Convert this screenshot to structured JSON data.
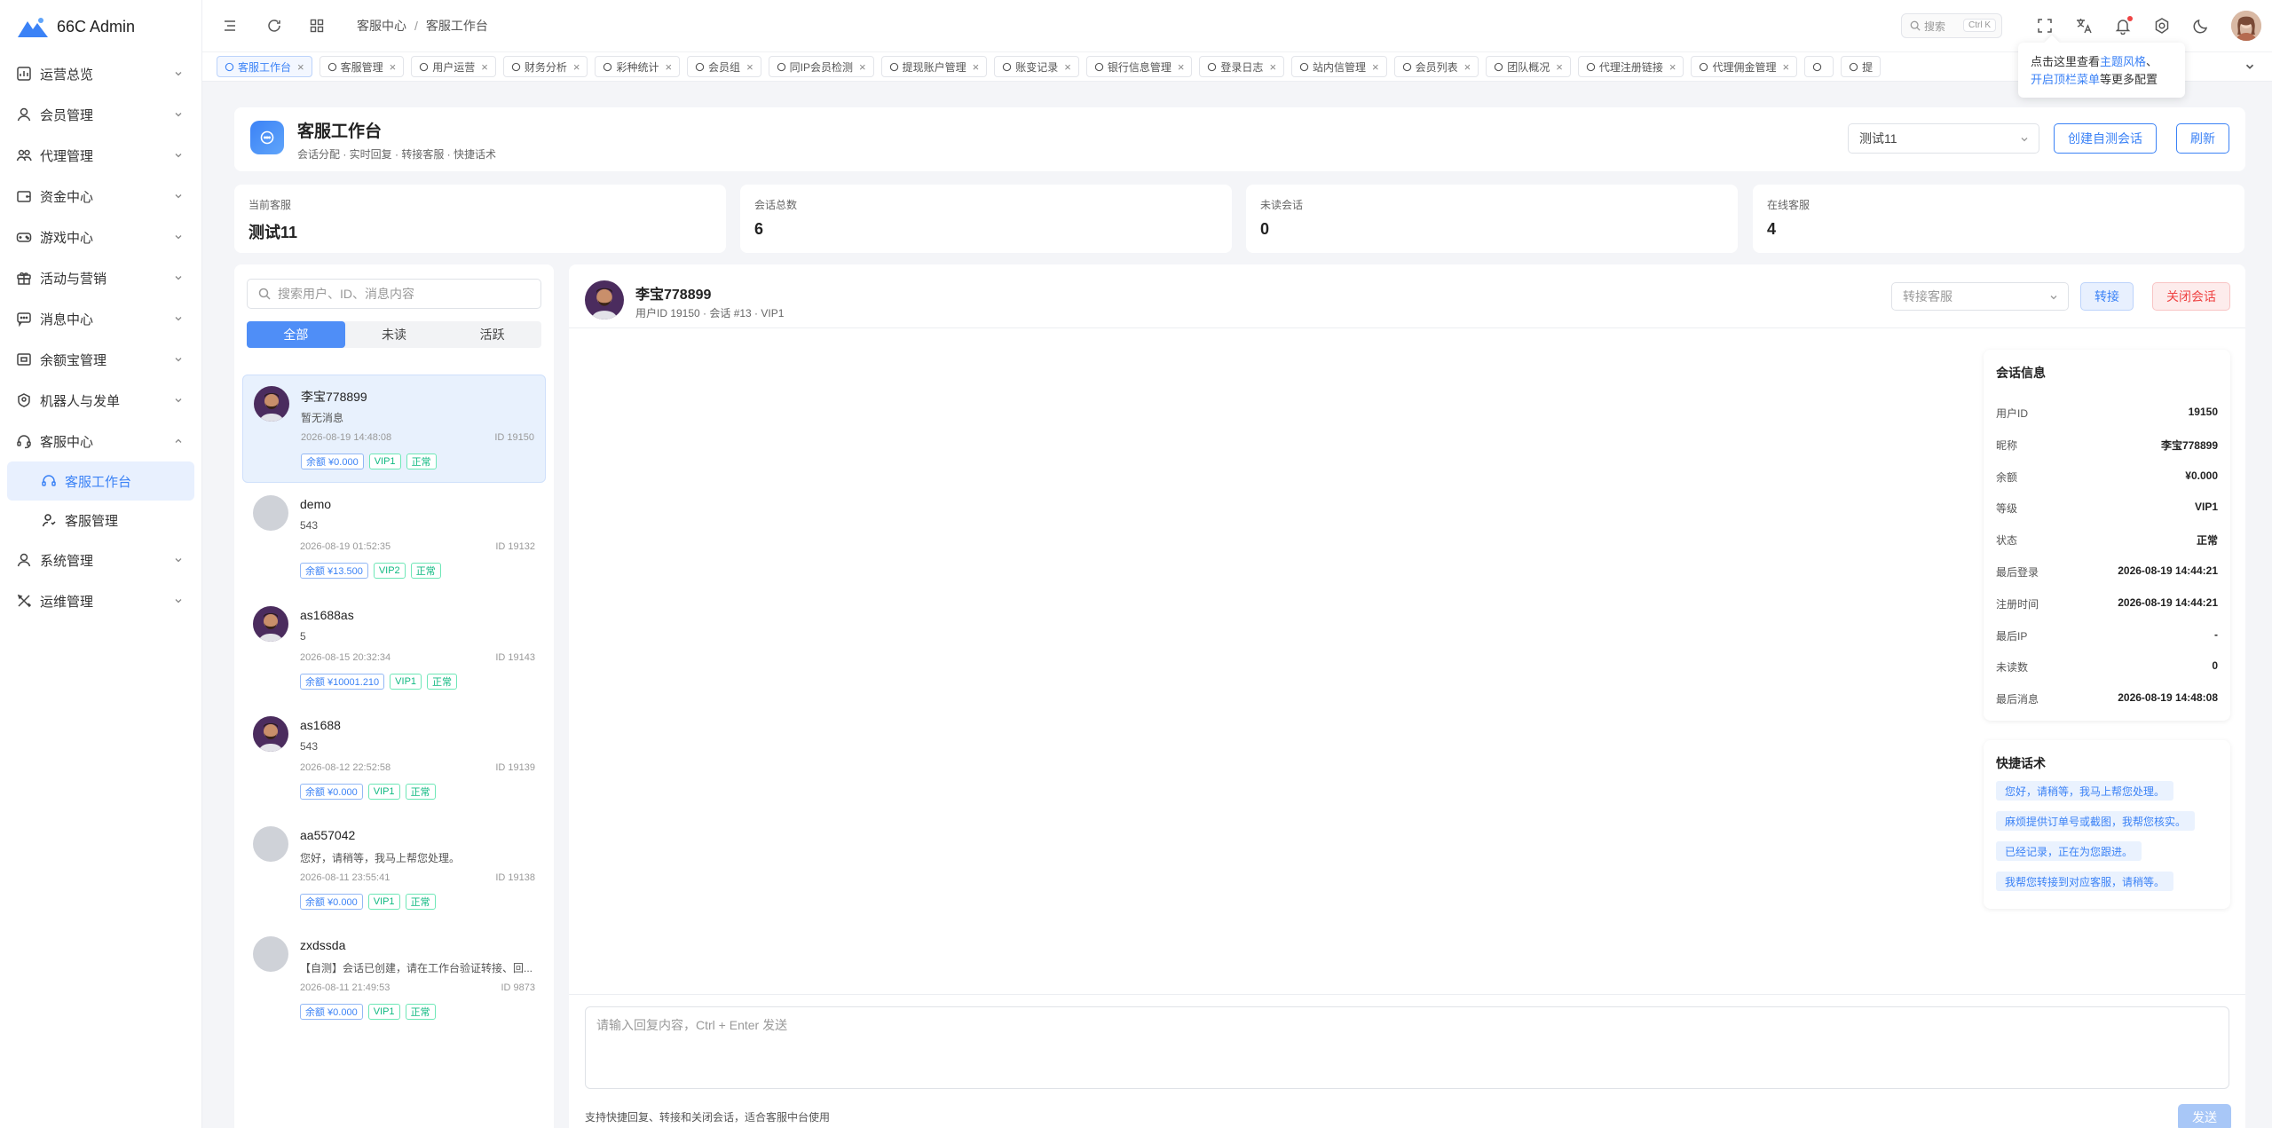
{
  "app": {
    "name": "66C Admin"
  },
  "sidebar": {
    "items": [
      {
        "label": "运营总览"
      },
      {
        "label": "会员管理"
      },
      {
        "label": "代理管理"
      },
      {
        "label": "资金中心"
      },
      {
        "label": "游戏中心"
      },
      {
        "label": "活动与营销"
      },
      {
        "label": "消息中心"
      },
      {
        "label": "余额宝管理"
      },
      {
        "label": "机器人与发单"
      },
      {
        "label": "客服中心"
      },
      {
        "label": "系统管理"
      },
      {
        "label": "运维管理"
      }
    ],
    "sub_items": [
      {
        "label": "客服工作台"
      },
      {
        "label": "客服管理"
      }
    ]
  },
  "breadcrumb": {
    "root": "客服中心",
    "sep": "/",
    "current": "客服工作台"
  },
  "search": {
    "placeholder": "搜索",
    "shortcut": "Ctrl K"
  },
  "tabs": [
    {
      "label": "客服工作台"
    },
    {
      "label": "客服管理"
    },
    {
      "label": "用户运营"
    },
    {
      "label": "财务分析"
    },
    {
      "label": "彩种统计"
    },
    {
      "label": "会员组"
    },
    {
      "label": "同IP会员检测"
    },
    {
      "label": "提现账户管理"
    },
    {
      "label": "账变记录"
    },
    {
      "label": "银行信息管理"
    },
    {
      "label": "登录日志"
    },
    {
      "label": "站内信管理"
    },
    {
      "label": "会员列表"
    },
    {
      "label": "团队概况"
    },
    {
      "label": "代理注册链接"
    },
    {
      "label": "代理佣金管理"
    },
    {
      "label": ""
    },
    {
      "label": "提"
    }
  ],
  "tooltip": {
    "pre": "点击这里查看",
    "link1": "主题风格",
    "mid": "、",
    "link2": "开启顶栏菜单",
    "post": "等更多配置"
  },
  "header": {
    "title": "客服工作台",
    "subtitle": "会话分配 · 实时回复 · 转接客服 · 快捷话术",
    "agent_select": "测试11",
    "create_btn": "创建自测会话",
    "refresh_btn": "刷新"
  },
  "stats": [
    {
      "label": "当前客服",
      "value": "测试11"
    },
    {
      "label": "会话总数",
      "value": "6"
    },
    {
      "label": "未读会话",
      "value": "0"
    },
    {
      "label": "在线客服",
      "value": "4"
    }
  ],
  "list": {
    "search_placeholder": "搜索用户、ID、消息内容",
    "filters": [
      "全部",
      "未读",
      "活跃"
    ],
    "conversations": [
      {
        "name": "李宝778899",
        "msg": "暂无消息",
        "time": "2026-08-19 14:48:08",
        "id": "ID 19150",
        "balance": "余额 ¥0.000",
        "vip": "VIP1",
        "status": "正常"
      },
      {
        "name": "demo",
        "msg": "543",
        "time": "2026-08-19 01:52:35",
        "id": "ID 19132",
        "balance": "余额 ¥13.500",
        "vip": "VIP2",
        "status": "正常"
      },
      {
        "name": "as1688as",
        "msg": "5",
        "time": "2026-08-15 20:32:34",
        "id": "ID 19143",
        "balance": "余额 ¥10001.210",
        "vip": "VIP1",
        "status": "正常"
      },
      {
        "name": "as1688",
        "msg": "543",
        "time": "2026-08-12 22:52:58",
        "id": "ID 19139",
        "balance": "余额 ¥0.000",
        "vip": "VIP1",
        "status": "正常"
      },
      {
        "name": "aa557042",
        "msg": "您好，请稍等，我马上帮您处理。",
        "time": "2026-08-11 23:55:41",
        "id": "ID 19138",
        "balance": "余额 ¥0.000",
        "vip": "VIP1",
        "status": "正常"
      },
      {
        "name": "zxdssda",
        "msg": "【自测】会话已创建，请在工作台验证转接、回...",
        "time": "2026-08-11 21:49:53",
        "id": "ID 9873",
        "balance": "余额 ¥0.000",
        "vip": "VIP1",
        "status": "正常"
      }
    ]
  },
  "chat": {
    "name": "李宝778899",
    "meta": "用户ID 19150 · 会话 #13 · VIP1",
    "transfer_placeholder": "转接客服",
    "transfer_btn": "转接",
    "close_btn": "关闭会话",
    "compose_placeholder": "请输入回复内容，Ctrl + Enter 发送",
    "hint": "支持快捷回复、转接和关闭会话，适合客服中台使用",
    "send_btn": "发送"
  },
  "info": {
    "title": "会话信息",
    "rows": [
      {
        "k": "用户ID",
        "v": "19150"
      },
      {
        "k": "昵称",
        "v": "李宝778899"
      },
      {
        "k": "余额",
        "v": "¥0.000"
      },
      {
        "k": "等级",
        "v": "VIP1"
      },
      {
        "k": "状态",
        "v": "正常"
      },
      {
        "k": "最后登录",
        "v": "2026-08-19 14:44:21"
      },
      {
        "k": "注册时间",
        "v": "2026-08-19 14:44:21"
      },
      {
        "k": "最后IP",
        "v": "-"
      },
      {
        "k": "未读数",
        "v": "0"
      },
      {
        "k": "最后消息",
        "v": "2026-08-19 14:48:08"
      }
    ]
  },
  "quick": {
    "title": "快捷话术",
    "items": [
      "您好，请稍等，我马上帮您处理。",
      "麻烦提供订单号或截图，我帮您核实。",
      "已经记录，正在为您跟进。",
      "我帮您转接到对应客服，请稍等。"
    ]
  },
  "colors": {
    "accent": "#3b82f6",
    "danger": "#ef4444",
    "success": "#10b981"
  }
}
